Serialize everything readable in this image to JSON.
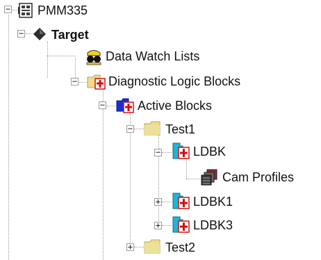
{
  "tree": {
    "nodes": [
      {
        "label": "PMM335",
        "expander": "⊟",
        "bold": false
      },
      {
        "label": "Target",
        "expander": "⊟",
        "bold": true
      },
      {
        "label": "Data Watch Lists",
        "expander": "",
        "bold": false
      },
      {
        "label": "Diagnostic Logic Blocks",
        "expander": "⊟",
        "bold": false
      },
      {
        "label": "Active Blocks",
        "expander": "⊟",
        "bold": false
      },
      {
        "label": "Test1",
        "expander": "⊟",
        "bold": false
      },
      {
        "label": "LDBK",
        "expander": "⊟",
        "bold": false
      },
      {
        "label": "Cam Profiles",
        "expander": "",
        "bold": false
      },
      {
        "label": "LDBK1",
        "expander": "⊞",
        "bold": false
      },
      {
        "label": "LDBK3",
        "expander": "⊞",
        "bold": false
      },
      {
        "label": "Test2",
        "expander": "⊞",
        "bold": false
      }
    ]
  }
}
